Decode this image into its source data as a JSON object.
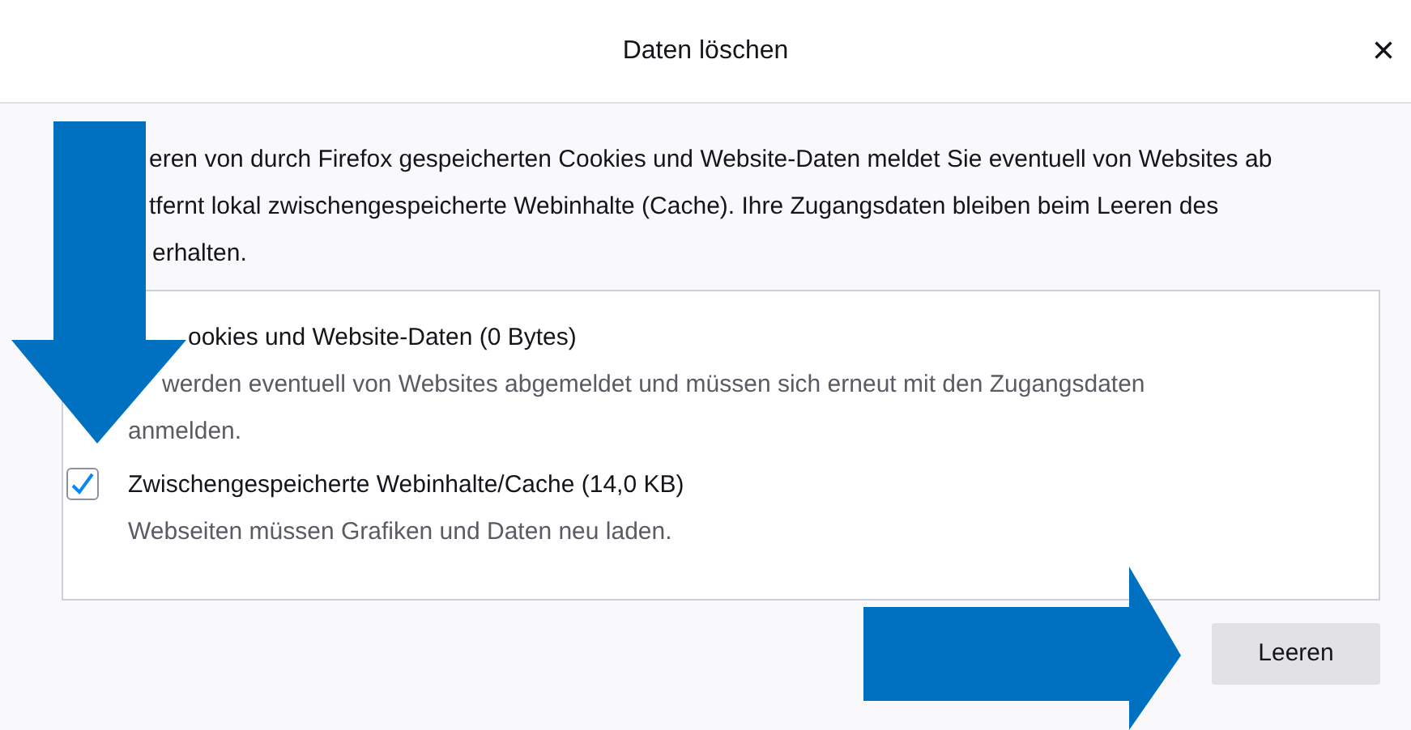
{
  "window": {
    "title": "Daten löschen",
    "close": "×"
  },
  "intro_lines": [
    "eren von durch Firefox gespeicherten Cookies und Website-Daten meldet Sie eventuell von Websites ab",
    "tfernt lokal zwischengespeicherte Webinhalte (Cache). Ihre Zugangsdaten bleiben beim Leeren des",
    "erhalten."
  ],
  "options": [
    {
      "kind": "covered",
      "label": "ookies und Website-Daten (0 Bytes)",
      "description": [
        "werden eventuell von Websites abgemeldet und müssen sich erneut mit den Zugangsdaten",
        "anmelden."
      ]
    },
    {
      "kind": "checkbox",
      "checked": true,
      "label": "Zwischengespeicherte Webinhalte/Cache (14,0 KB)",
      "description": [
        "Webseiten müssen Grafiken und Daten neu laden."
      ]
    }
  ],
  "buttons": [
    {
      "kind": "text",
      "label": "Leeren"
    }
  ]
}
